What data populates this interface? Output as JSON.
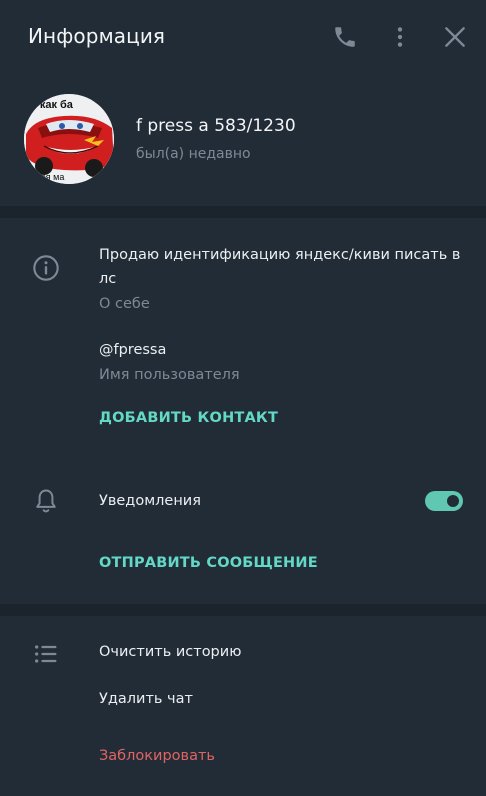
{
  "header": {
    "title": "Информация"
  },
  "profile": {
    "name": "f press a 583/1230",
    "status": "был(а) недавно",
    "avatar_caption_top": "и как ба",
    "avatar_caption_bottom": "твоя ма"
  },
  "info": {
    "bio": "Продаю идентификацию яндекс/киви писать в лс",
    "bio_label": "О себе",
    "username": "@fpressa",
    "username_label": "Имя пользователя",
    "add_contact": "ДОБАВИТЬ КОНТАКТ"
  },
  "notifications": {
    "label": "Уведомления",
    "enabled": true,
    "send_message": "ОТПРАВИТЬ СООБЩЕНИЕ"
  },
  "actions": {
    "clear_history": "Очистить историю",
    "delete_chat": "Удалить чат",
    "block": "Заблокировать"
  },
  "colors": {
    "background": "#222c36",
    "divider": "#1b242d",
    "accent": "#63d8c6",
    "danger": "#e06464",
    "muted": "#7d8a96"
  }
}
